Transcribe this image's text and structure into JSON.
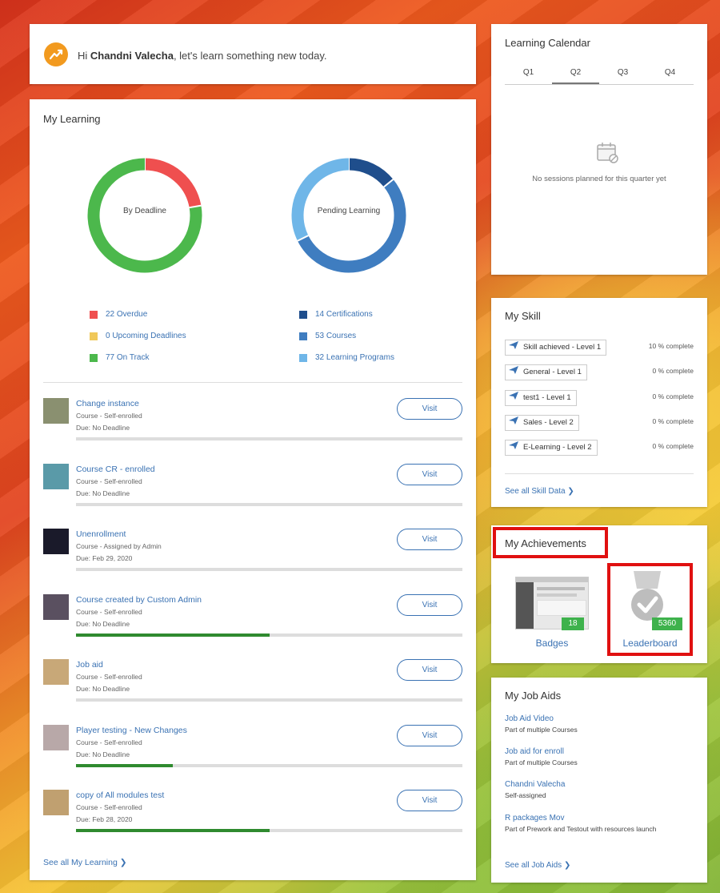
{
  "greeting": {
    "prefix": "Hi ",
    "name": "Chandni Valecha",
    "suffix": ", let's learn something new today."
  },
  "my_learning": {
    "title": "My Learning",
    "donut_deadline": {
      "label": "By Deadline",
      "segments": [
        {
          "name": "Overdue",
          "value": 22,
          "color": "#ef4f4f"
        },
        {
          "name": "Upcoming Deadlines",
          "value": 0,
          "color": "#f0c85a"
        },
        {
          "name": "On Track",
          "value": 77,
          "color": "#4cb84c"
        }
      ]
    },
    "donut_pending": {
      "label": "Pending Learning",
      "segments": [
        {
          "name": "Certifications",
          "value": 14,
          "color": "#1f4e8c"
        },
        {
          "name": "Courses",
          "value": 53,
          "color": "#3f7dc0"
        },
        {
          "name": "Learning Programs",
          "value": 32,
          "color": "#6fb6e8"
        }
      ]
    },
    "legend_left": [
      "22 Overdue",
      "0 Upcoming Deadlines",
      "77 On Track"
    ],
    "legend_right": [
      "14 Certifications",
      "53 Courses",
      "32 Learning Programs"
    ],
    "visit_label": "Visit",
    "courses": [
      {
        "name": "Change instance",
        "type": "Course - Self-enrolled",
        "due": "Due: No Deadline",
        "progress": 0,
        "thumb": "#8a9070"
      },
      {
        "name": "Course CR - enrolled",
        "type": "Course - Self-enrolled",
        "due": "Due: No Deadline",
        "progress": 0,
        "thumb": "#5a9aa8"
      },
      {
        "name": "Unenrollment",
        "type": "Course - Assigned by Admin",
        "due": "Due: Feb 29, 2020",
        "progress": 0,
        "thumb": "#1a1a2a"
      },
      {
        "name": "Course created by Custom Admin",
        "type": "Course - Self-enrolled",
        "due": "Due: No Deadline",
        "progress": 0.5,
        "thumb": "#5a5060"
      },
      {
        "name": "Job aid",
        "type": "Course - Self-enrolled",
        "due": "Due: No Deadline",
        "progress": 0,
        "thumb": "#c8a878"
      },
      {
        "name": "Player testing - New Changes",
        "type": "Course - Self-enrolled",
        "due": "Due: No Deadline",
        "progress": 0.25,
        "thumb": "#b8a8a8"
      },
      {
        "name": "copy of All modules test",
        "type": "Course - Self-enrolled",
        "due": "Due: Feb 28, 2020",
        "progress": 0.5,
        "thumb": "#c0a070"
      }
    ],
    "see_all": "See all My Learning"
  },
  "calendar": {
    "title": "Learning Calendar",
    "tabs": [
      "Q1",
      "Q2",
      "Q3",
      "Q4"
    ],
    "active_tab": "Q2",
    "empty_text": "No sessions planned for this quarter yet"
  },
  "skills": {
    "title": "My Skill",
    "items": [
      {
        "name": "Skill achieved - Level 1",
        "pct": "10 % complete"
      },
      {
        "name": "General - Level 1",
        "pct": "0 % complete"
      },
      {
        "name": "test1 - Level 1",
        "pct": "0 % complete"
      },
      {
        "name": "Sales - Level 2",
        "pct": "0 % complete"
      },
      {
        "name": "E-Learning - Level 2",
        "pct": "0 % complete"
      }
    ],
    "see_all": "See all Skill Data"
  },
  "achievements": {
    "title": "My Achievements",
    "badges_count": "18",
    "badges_label": "Badges",
    "leaderboard_count": "5360",
    "leaderboard_label": "Leaderboard"
  },
  "job_aids": {
    "title": "My Job Aids",
    "items": [
      {
        "name": "Job Aid Video",
        "sub": "Part of multiple Courses"
      },
      {
        "name": "Job aid for enroll",
        "sub": "Part of multiple Courses"
      },
      {
        "name": "Chandni Valecha",
        "sub": "Self-assigned"
      },
      {
        "name": "R packages Mov",
        "sub": "Part of Prework and Testout with resources launch"
      }
    ],
    "see_all": "See all Job Aids"
  }
}
